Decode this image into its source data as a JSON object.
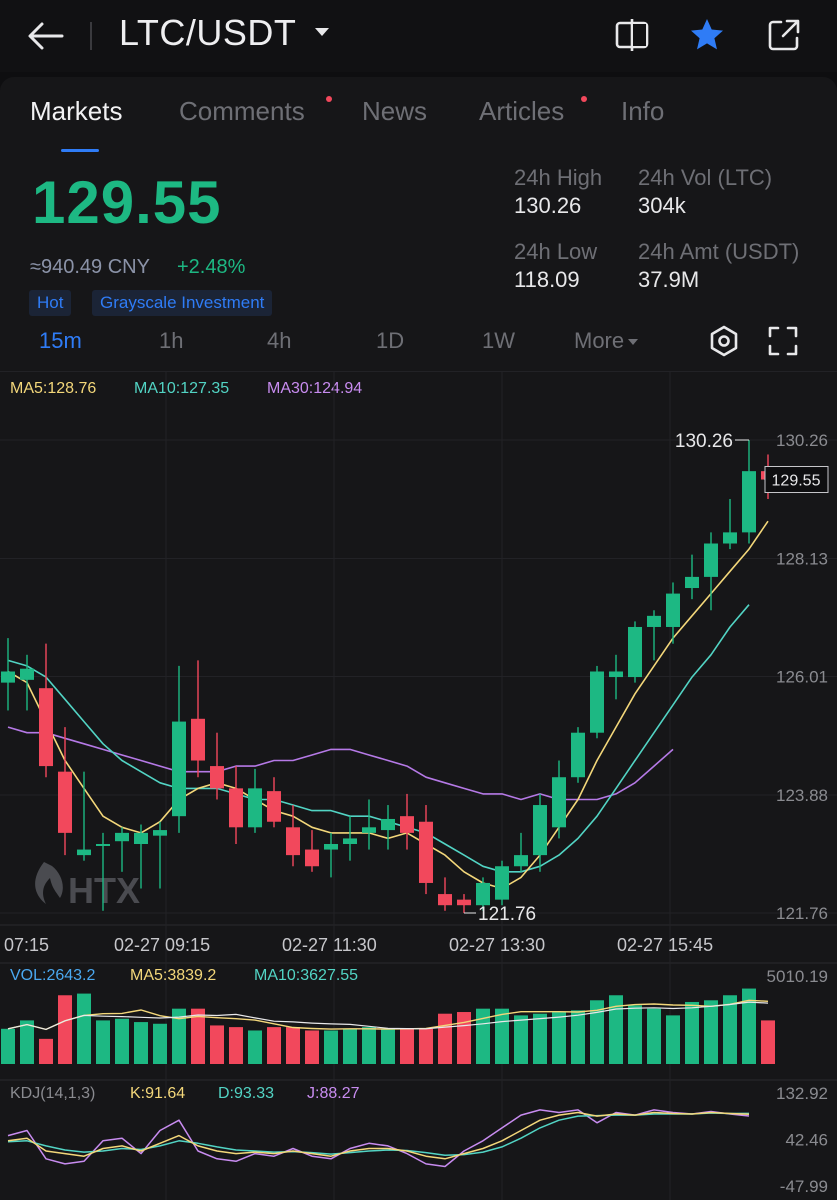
{
  "header": {
    "pair": "LTC/USDT",
    "icons": [
      "back-arrow-icon",
      "caret-down-icon",
      "compare-icon",
      "star-icon",
      "share-icon"
    ],
    "colors": {
      "star": "#2f7cf6"
    }
  },
  "tabs": [
    {
      "label": "Markets",
      "active": true,
      "dot": false
    },
    {
      "label": "Comments",
      "active": false,
      "dot": true
    },
    {
      "label": "News",
      "active": false,
      "dot": false
    },
    {
      "label": "Articles",
      "active": false,
      "dot": true
    },
    {
      "label": "Info",
      "active": false,
      "dot": false
    }
  ],
  "ticker": {
    "price": "129.55",
    "cny": "≈940.49 CNY",
    "change": "+2.48%",
    "tags": [
      "Hot",
      "Grayscale Investment"
    ],
    "stats": {
      "high_label": "24h High",
      "high_value": "130.26",
      "vol_label": "24h Vol (LTC)",
      "vol_value": "304k",
      "low_label": "24h Low",
      "low_value": "118.09",
      "amt_label": "24h Amt (USDT)",
      "amt_value": "37.9M"
    },
    "colors": {
      "up": "#1db883",
      "down": "#f2485c",
      "accent": "#2f7cf6"
    }
  },
  "intervals": {
    "items": [
      "15m",
      "1h",
      "4h",
      "1D",
      "1W",
      "More"
    ],
    "active": "15m",
    "icons": [
      "indicator-settings-icon",
      "fullscreen-icon"
    ]
  },
  "chart_data": {
    "type": "candlestick",
    "ma_legend": {
      "ma5": "MA5:128.76",
      "ma10": "MA10:127.35",
      "ma30": "MA30:124.94"
    },
    "y_ticks": [
      "130.26",
      "128.13",
      "126.01",
      "123.88",
      "121.76"
    ],
    "ylim": [
      121.76,
      130.26
    ],
    "x_ticks": [
      "07:15",
      "02-27 09:15",
      "02-27 11:30",
      "02-27 13:30",
      "02-27 15:45"
    ],
    "last_price": "129.55",
    "high_marker": "130.26",
    "low_marker": "121.76",
    "watermark": "HTX",
    "candles": [
      {
        "o": 125.9,
        "h": 126.7,
        "l": 125.4,
        "c": 126.1
      },
      {
        "o": 125.95,
        "h": 126.4,
        "l": 125.4,
        "c": 126.15
      },
      {
        "o": 125.8,
        "h": 126.6,
        "l": 124.2,
        "c": 124.4
      },
      {
        "o": 124.3,
        "h": 125.1,
        "l": 122.8,
        "c": 123.2
      },
      {
        "o": 122.8,
        "h": 124.3,
        "l": 122.7,
        "c": 122.9
      },
      {
        "o": 123.0,
        "h": 123.2,
        "l": 121.8,
        "c": 123.0
      },
      {
        "o": 123.05,
        "h": 123.3,
        "l": 122.5,
        "c": 123.2
      },
      {
        "o": 123.0,
        "h": 123.35,
        "l": 122.2,
        "c": 123.2
      },
      {
        "o": 123.15,
        "h": 123.4,
        "l": 122.2,
        "c": 123.25
      },
      {
        "o": 123.5,
        "h": 126.2,
        "l": 123.2,
        "c": 125.2
      },
      {
        "o": 125.25,
        "h": 126.3,
        "l": 124.2,
        "c": 124.5
      },
      {
        "o": 124.4,
        "h": 125.0,
        "l": 123.8,
        "c": 124.0
      },
      {
        "o": 124.0,
        "h": 124.4,
        "l": 123.0,
        "c": 123.3
      },
      {
        "o": 123.3,
        "h": 124.35,
        "l": 123.2,
        "c": 124.0
      },
      {
        "o": 123.95,
        "h": 124.2,
        "l": 123.3,
        "c": 123.4
      },
      {
        "o": 123.3,
        "h": 123.7,
        "l": 122.6,
        "c": 122.8
      },
      {
        "o": 122.9,
        "h": 123.25,
        "l": 122.5,
        "c": 122.6
      },
      {
        "o": 122.9,
        "h": 123.2,
        "l": 122.4,
        "c": 123.0
      },
      {
        "o": 123.0,
        "h": 123.5,
        "l": 122.7,
        "c": 123.1
      },
      {
        "o": 123.2,
        "h": 123.8,
        "l": 122.9,
        "c": 123.3
      },
      {
        "o": 123.25,
        "h": 123.7,
        "l": 122.9,
        "c": 123.45
      },
      {
        "o": 123.5,
        "h": 123.9,
        "l": 122.9,
        "c": 123.2
      },
      {
        "o": 123.4,
        "h": 123.7,
        "l": 122.1,
        "c": 122.3
      },
      {
        "o": 122.1,
        "h": 122.4,
        "l": 121.8,
        "c": 121.9
      },
      {
        "o": 122.0,
        "h": 122.1,
        "l": 121.76,
        "c": 121.9
      },
      {
        "o": 121.9,
        "h": 122.4,
        "l": 121.8,
        "c": 122.3
      },
      {
        "o": 122.0,
        "h": 122.7,
        "l": 121.9,
        "c": 122.6
      },
      {
        "o": 122.6,
        "h": 123.2,
        "l": 122.5,
        "c": 122.8
      },
      {
        "o": 122.8,
        "h": 123.9,
        "l": 122.5,
        "c": 123.7
      },
      {
        "o": 123.3,
        "h": 124.5,
        "l": 123.1,
        "c": 124.2
      },
      {
        "o": 124.2,
        "h": 125.1,
        "l": 124.1,
        "c": 125.0
      },
      {
        "o": 125.0,
        "h": 126.2,
        "l": 124.9,
        "c": 126.1
      },
      {
        "o": 126.0,
        "h": 126.4,
        "l": 125.6,
        "c": 126.1
      },
      {
        "o": 126.0,
        "h": 127.0,
        "l": 125.9,
        "c": 126.9
      },
      {
        "o": 126.9,
        "h": 127.2,
        "l": 126.3,
        "c": 127.1
      },
      {
        "o": 126.9,
        "h": 127.7,
        "l": 126.6,
        "c": 127.5
      },
      {
        "o": 127.6,
        "h": 128.2,
        "l": 127.4,
        "c": 127.8
      },
      {
        "o": 127.8,
        "h": 128.6,
        "l": 127.2,
        "c": 128.4
      },
      {
        "o": 128.4,
        "h": 129.2,
        "l": 128.3,
        "c": 128.6
      },
      {
        "o": 128.6,
        "h": 130.26,
        "l": 128.4,
        "c": 129.7
      },
      {
        "o": 129.7,
        "h": 130.0,
        "l": 129.2,
        "c": 129.55
      }
    ],
    "ma5": [
      126.1,
      125.9,
      125.2,
      124.5,
      124.0,
      123.5,
      123.3,
      123.2,
      123.4,
      123.8,
      124.0,
      124.1,
      124.0,
      123.8,
      123.6,
      123.5,
      123.3,
      123.2,
      123.2,
      123.2,
      123.1,
      123.2,
      123.0,
      122.8,
      122.5,
      122.3,
      122.2,
      122.4,
      122.8,
      123.3,
      123.8,
      124.5,
      125.1,
      125.7,
      126.2,
      126.7,
      127.1,
      127.5,
      127.9,
      128.3,
      128.8
    ],
    "ma10": [
      126.3,
      126.2,
      126.0,
      125.6,
      125.2,
      124.8,
      124.5,
      124.3,
      124.1,
      124.0,
      124.0,
      124.0,
      123.9,
      123.8,
      123.8,
      123.7,
      123.6,
      123.6,
      123.5,
      123.5,
      123.4,
      123.3,
      123.2,
      123.0,
      122.8,
      122.6,
      122.5,
      122.5,
      122.6,
      122.8,
      123.1,
      123.5,
      124.0,
      124.5,
      125.0,
      125.5,
      126.0,
      126.4,
      126.9,
      127.3
    ],
    "ma30": [
      125.1,
      125.0,
      125.0,
      124.9,
      124.8,
      124.7,
      124.6,
      124.5,
      124.4,
      124.3,
      124.3,
      124.3,
      124.4,
      124.4,
      124.5,
      124.5,
      124.6,
      124.7,
      124.7,
      124.6,
      124.5,
      124.4,
      124.2,
      124.1,
      124.0,
      123.9,
      123.9,
      123.8,
      123.9,
      123.8,
      123.8,
      123.8,
      123.9,
      124.1,
      124.4,
      124.7
    ],
    "volume": {
      "legend": {
        "vol": "VOL:2643.2",
        "ma5": "MA5:3839.2",
        "ma10": "MA10:3627.55"
      },
      "max_label": "5010.19",
      "ymax": 5010.19,
      "values": [
        2100,
        2600,
        1500,
        4100,
        4200,
        2600,
        2700,
        2500,
        2400,
        3300,
        3300,
        2300,
        2200,
        2000,
        2200,
        2200,
        2000,
        2000,
        2100,
        2200,
        2100,
        2100,
        2100,
        3000,
        3100,
        3300,
        3300,
        2900,
        3000,
        3100,
        3200,
        3800,
        4100,
        3500,
        3300,
        2900,
        3700,
        3800,
        4100,
        4500,
        2600
      ]
    },
    "kdj": {
      "legend": {
        "title": "KDJ(14,1,3)",
        "k": "K:91.64",
        "d": "D:93.33",
        "j": "J:88.27"
      },
      "y_ticks": [
        "132.92",
        "42.46",
        "-47.99"
      ],
      "ylim": [
        -47.99,
        132.92
      ],
      "k": [
        40,
        45,
        20,
        15,
        10,
        25,
        30,
        20,
        35,
        50,
        30,
        20,
        15,
        18,
        15,
        20,
        15,
        10,
        20,
        25,
        25,
        20,
        10,
        5,
        15,
        25,
        40,
        60,
        80,
        90,
        95,
        88,
        92,
        90,
        95,
        93,
        92,
        95,
        93,
        91.64
      ],
      "d": [
        38,
        40,
        30,
        22,
        18,
        20,
        25,
        23,
        30,
        40,
        35,
        28,
        22,
        20,
        18,
        19,
        17,
        14,
        17,
        20,
        22,
        21,
        17,
        12,
        13,
        18,
        28,
        45,
        65,
        80,
        88,
        89,
        90,
        90,
        92,
        92,
        92,
        94,
        93,
        93.33
      ],
      "j": [
        50,
        60,
        5,
        -5,
        0,
        40,
        45,
        15,
        60,
        80,
        20,
        5,
        0,
        15,
        10,
        25,
        10,
        5,
        25,
        35,
        30,
        15,
        -5,
        -10,
        20,
        40,
        65,
        90,
        100,
        95,
        100,
        75,
        95,
        90,
        100,
        95,
        92,
        97,
        92,
        88.27
      ]
    }
  }
}
